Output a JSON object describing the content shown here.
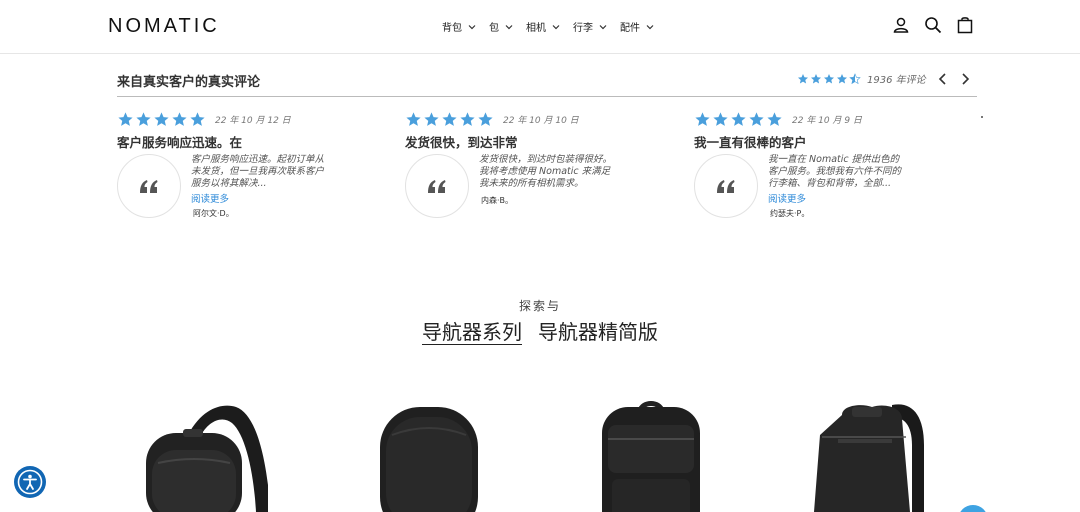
{
  "header": {
    "logo": "NOMATIC",
    "nav": [
      {
        "label": "背包"
      },
      {
        "label": "包"
      },
      {
        "label": "相机"
      },
      {
        "label": "行李"
      },
      {
        "label": "配件"
      }
    ],
    "icons": [
      "account-icon",
      "search-icon",
      "cart-icon"
    ]
  },
  "reviews": {
    "title": "来自真实客户的真实评论",
    "average_rating": 4.5,
    "count_label": "1936 年评论",
    "star_color": "#4a9fdc",
    "items": [
      {
        "rating": 5,
        "date": "22 年 10 月 12 日",
        "headline": "客户服务响应迅速。在",
        "body_lines": [
          "客户服务响应迅速。起初订单从",
          "未发货，但一旦我再次联系客户",
          "服务以将其解决..."
        ],
        "read_more": "阅读更多",
        "author": "阿尔文·D。"
      },
      {
        "rating": 5,
        "date": "22 年 10 月 10 日",
        "headline": "发货很快，到达非常",
        "body_lines": [
          "发货很快，到达时包装得很好。",
          "我将考虑使用 Nomatic 来满足",
          "我未来的所有相机需求。"
        ],
        "read_more": "",
        "author": "内森·B。"
      },
      {
        "rating": 5,
        "date": "22 年 10 月 9 日",
        "headline": "我一直有很棒的客户",
        "body_lines": [
          "我一直在 Nomatic 提供出色的",
          "客户服务。我想我有六件不同的",
          "行李箱、背包和背带，全部..."
        ],
        "read_more": "阅读更多",
        "author": "约瑟夫·P。"
      }
    ]
  },
  "explore": {
    "subtitle": "探索与",
    "tabs": [
      {
        "label": "导航器系列",
        "active": true
      },
      {
        "label": "导航器精简版",
        "active": false
      }
    ]
  },
  "products": [
    {
      "name": "sling-bag"
    },
    {
      "name": "round-backpack"
    },
    {
      "name": "travel-pack"
    },
    {
      "name": "navigator-backpack"
    }
  ],
  "colors": {
    "accent": "#4a9fdc",
    "link": "#2e8ad8",
    "a11y": "#1166b3"
  }
}
